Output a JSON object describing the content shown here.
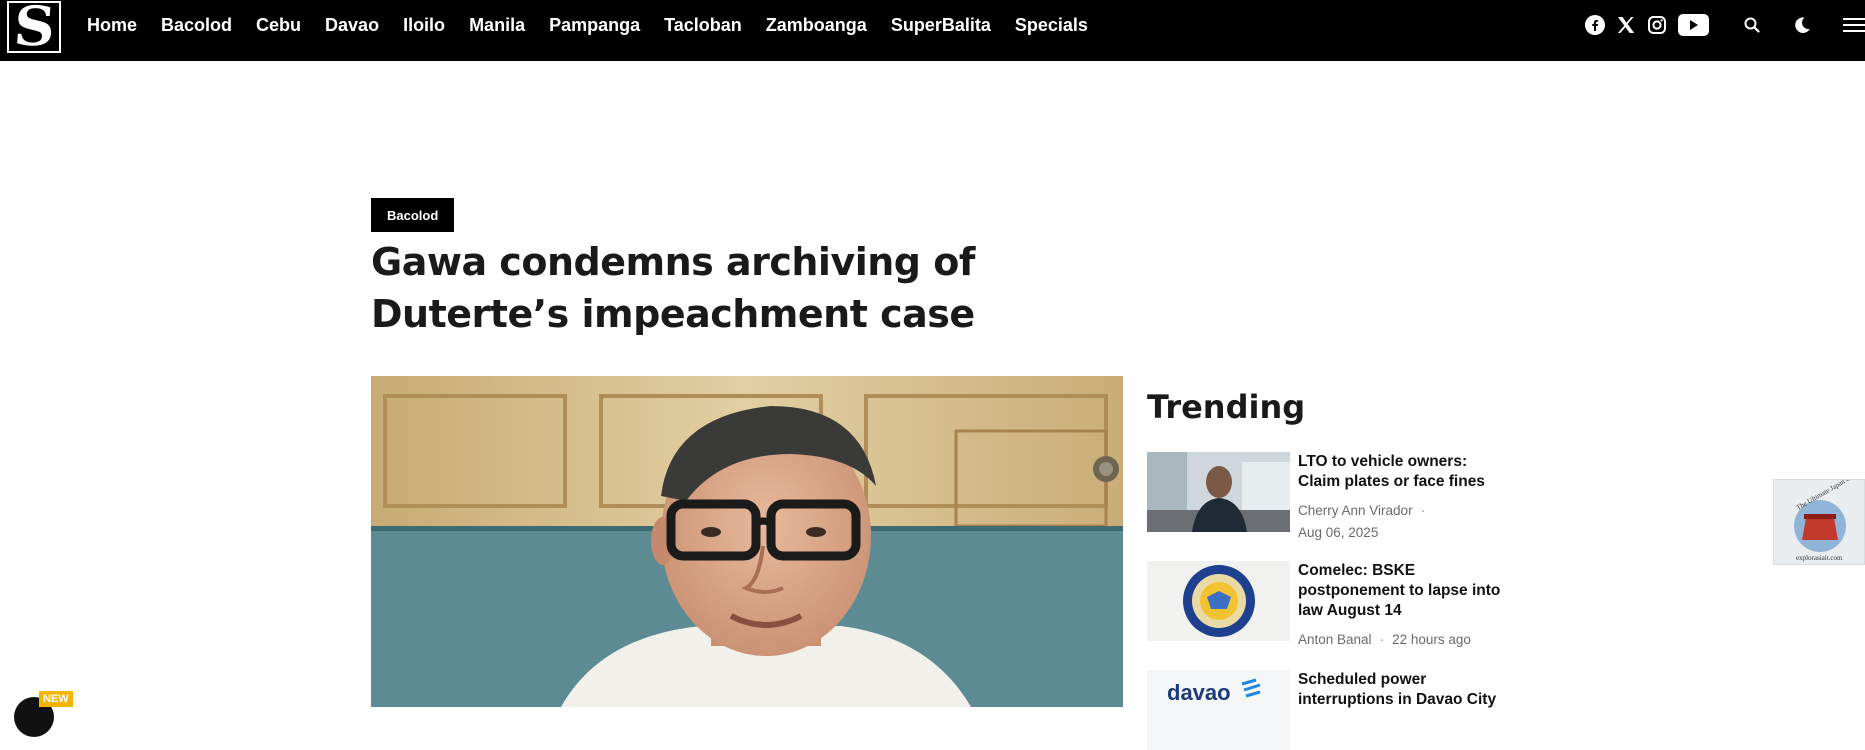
{
  "logo": {
    "letter": "S"
  },
  "nav": {
    "items": [
      "Home",
      "Bacolod",
      "Cebu",
      "Davao",
      "Iloilo",
      "Manila",
      "Pampanga",
      "Tacloban",
      "Zamboanga",
      "SuperBalita",
      "Specials"
    ],
    "icons": [
      "facebook-icon",
      "x-icon",
      "instagram-icon",
      "youtube-icon",
      "search-icon",
      "moon-icon",
      "menu-icon"
    ]
  },
  "article": {
    "category": "Bacolod",
    "title": "Gawa condemns archiving of Duterte’s impeachment case"
  },
  "trending": {
    "heading": "Trending",
    "items": [
      {
        "headline": "LTO to vehicle owners: Claim plates or face fines",
        "author": "Cherry Ann Virador",
        "date": "Aug 06, 2025"
      },
      {
        "headline": "Comelec: BSKE postponement to lapse into law August 14",
        "author": "Anton Banal",
        "date": "22 hours ago"
      },
      {
        "headline": "Scheduled power interruptions in Davao City",
        "author": "",
        "date": ""
      }
    ],
    "thumb3_text": "davao"
  },
  "side_ad": {
    "line1": "The Ultimate Japan Guide",
    "line2": "explorasiait.com"
  },
  "floating": {
    "new_label": "NEW"
  },
  "colors": {
    "nav_bg": "#000000",
    "badge_bg": "#000000",
    "accent_new": "#f4b400"
  }
}
